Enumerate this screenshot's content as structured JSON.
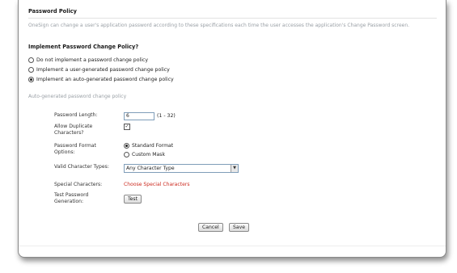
{
  "page": {
    "title": "Password Policy",
    "description": "OneSign can change a user's application password according to these specifications each time the user accesses the application's Change Password screen."
  },
  "policy": {
    "heading": "Implement Password Change Policy?",
    "options": [
      {
        "label": "Do not implement a password change policy",
        "selected": false
      },
      {
        "label": "Implement a user-generated password change policy",
        "selected": false
      },
      {
        "label": "Implement an auto-generated password change policy",
        "selected": true
      }
    ]
  },
  "auto": {
    "section_label": "Auto-generated password change policy",
    "length_label": "Password Length:",
    "length_value": "6",
    "length_range": "(1 - 32)",
    "duplicates_label": "Allow Duplicate Characters?",
    "duplicates_checked": true,
    "duplicates_mark": "✓",
    "format_label": "Password Format Options:",
    "format_options": [
      {
        "label": "Standard Format",
        "selected": true
      },
      {
        "label": "Custom Mask",
        "selected": false
      }
    ],
    "valid_types_label": "Valid Character Types:",
    "valid_types_value": "Any Character Type",
    "special_label": "Special Characters:",
    "special_link": "Choose Special Characters",
    "test_label": "Test Password Generation:",
    "test_button": "Test"
  },
  "footer": {
    "cancel": "Cancel",
    "save": "Save"
  },
  "colors": {
    "link": "#cc2a1f",
    "muted": "#9aa0a6"
  }
}
